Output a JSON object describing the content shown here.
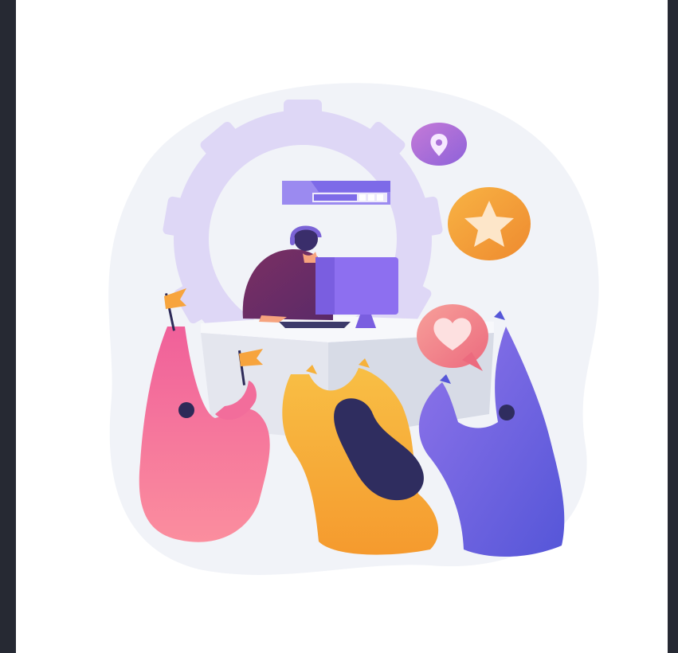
{
  "page": {
    "background_color": "#262933",
    "canvas_color": "#ffffff"
  },
  "illustration": {
    "subject": "customer-support-team-illustration",
    "colors": {
      "blob": "#f1f3f8",
      "gear": "#ddd4f6",
      "monitor": "#8d6ff0",
      "operator_shirt": "#7a2f6a",
      "desk": "#e7e9ef",
      "pink_person": "#f26d9b",
      "yellow_person": "#f6b13b",
      "purple_person": "#6f63e0",
      "hair_dark": "#2f2d5f",
      "star_badge": "#f4a43a",
      "heart_badge": "#f48b88",
      "location_badge": "#a96fd7",
      "flag": "#f7a43d"
    },
    "icons": [
      "location-pin-icon",
      "star-icon",
      "heart-icon",
      "gear-icon",
      "flag-icon"
    ],
    "progress_level": 0.55
  }
}
